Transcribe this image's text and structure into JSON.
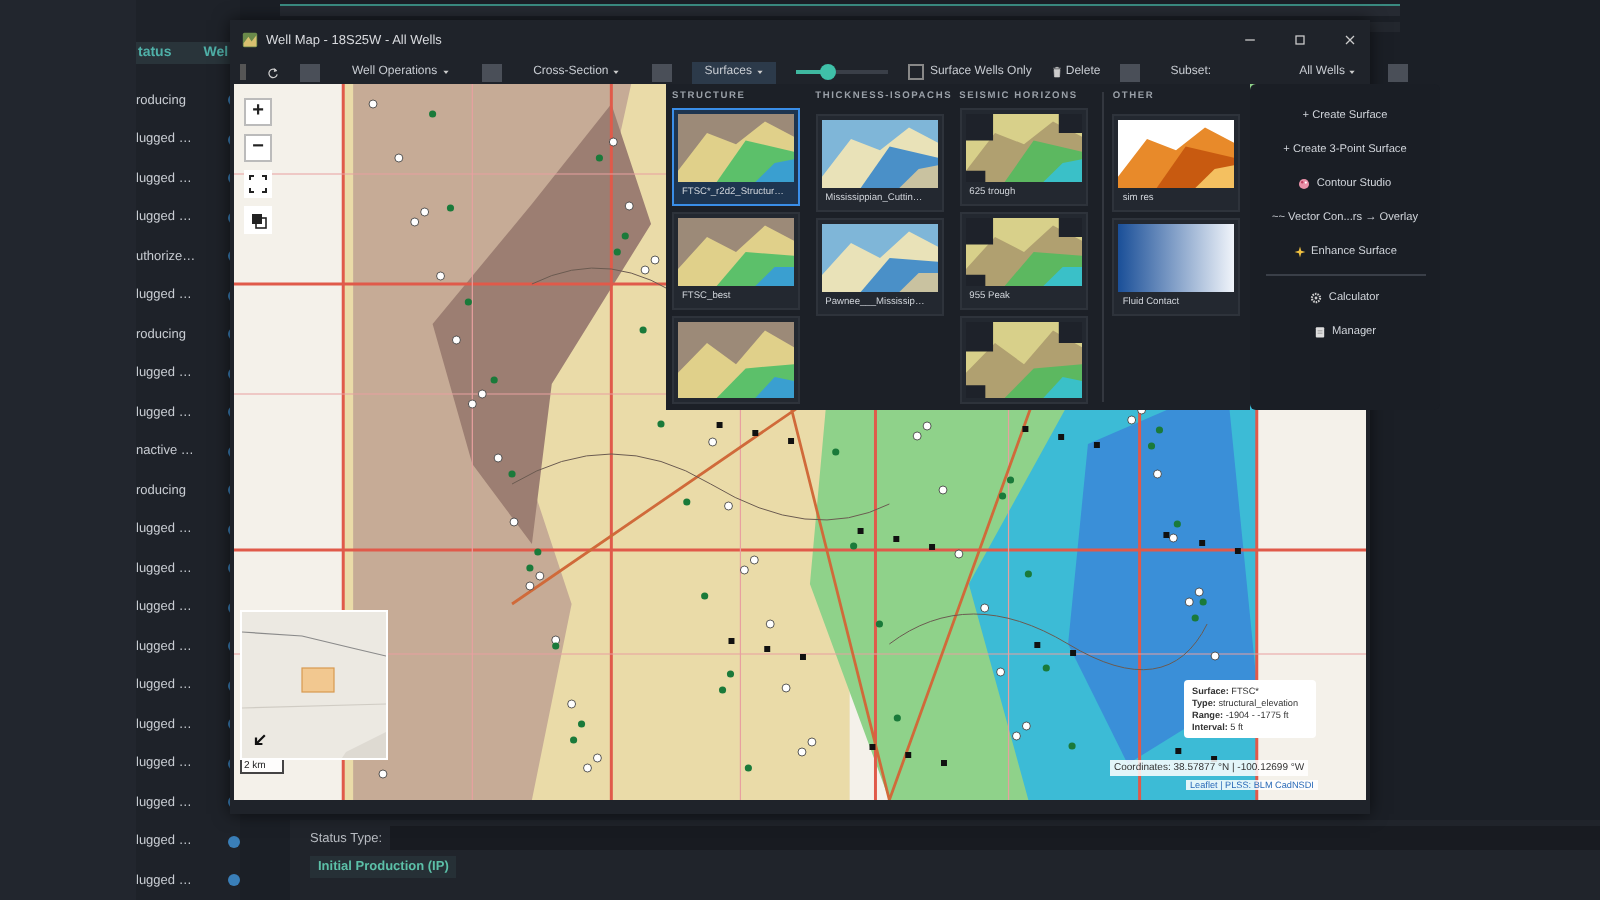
{
  "list": {
    "columns": [
      "tatus",
      "Wel"
    ],
    "rows": [
      {
        "status": "roducing"
      },
      {
        "status": "lugged …"
      },
      {
        "status": "lugged …"
      },
      {
        "status": "lugged …"
      },
      {
        "status": "uthorize…"
      },
      {
        "status": "lugged …"
      },
      {
        "status": "roducing"
      },
      {
        "status": "lugged …"
      },
      {
        "status": "lugged …"
      },
      {
        "status": "nactive …"
      },
      {
        "status": "roducing"
      },
      {
        "status": "lugged …"
      },
      {
        "status": "lugged …"
      },
      {
        "status": "lugged …"
      },
      {
        "status": "lugged …"
      },
      {
        "status": "lugged …"
      },
      {
        "status": "lugged …"
      },
      {
        "status": "lugged …"
      },
      {
        "status": "lugged …"
      },
      {
        "status": "lugged …"
      },
      {
        "status": "lugged …"
      }
    ]
  },
  "window": {
    "title": "Well Map - 18S25W - All Wells"
  },
  "toolbar": [
    {
      "kind": "handle"
    },
    {
      "kind": "refresh"
    },
    {
      "kind": "square"
    },
    {
      "kind": "menu",
      "label": "Well Operations",
      "selected": false
    },
    {
      "kind": "square"
    },
    {
      "kind": "menu",
      "label": "Cross-Section",
      "selected": false
    },
    {
      "kind": "square"
    },
    {
      "kind": "menu",
      "label": "Surfaces",
      "selected": true
    },
    {
      "kind": "slider",
      "level": 0.35
    },
    {
      "kind": "checkbox",
      "label": "Surface Wells Only",
      "checked": false
    },
    {
      "kind": "delete",
      "label": "Delete"
    },
    {
      "kind": "square"
    },
    {
      "kind": "label",
      "label": "Subset:"
    },
    {
      "kind": "menu",
      "label": "All Wells",
      "selected": false
    },
    {
      "kind": "square"
    }
  ],
  "surfaces_panel": {
    "categories": [
      {
        "title": "STRUCTURE",
        "surfaces": [
          {
            "name": "FTSC*_r2d2_Structur…",
            "selected": true
          },
          {
            "name": "FTSC_best",
            "selected": false
          },
          {
            "selected": false
          }
        ]
      },
      {
        "title": "THICKNESS-ISOPACHS",
        "surfaces": [
          {
            "name": "Mississippian_Cuttin…",
            "selected": false
          },
          {
            "name": "Pawnee___Mississip…",
            "selected": false
          }
        ]
      },
      {
        "title": "SEISMIC HORIZONS",
        "surfaces": [
          {
            "name": "625 trough",
            "selected": false
          },
          {
            "name": "955 Peak",
            "selected": false
          },
          {
            "selected": false
          }
        ]
      },
      {
        "title": "OTHER",
        "surfaces": [
          {
            "name": "sim res",
            "selected": false
          },
          {
            "name": "Fluid Contact",
            "selected": false
          }
        ]
      }
    ]
  },
  "surfaces_menu": [
    {
      "kind": "text",
      "label": "+ Create Surface"
    },
    {
      "kind": "text",
      "label": "+ Create 3-Point Surface"
    },
    {
      "kind": "palette",
      "label": "Contour Studio"
    },
    {
      "kind": "text",
      "label": "~~ Vector Con...rs → Overlay"
    },
    {
      "kind": "sparkle",
      "label": "Enhance Surface"
    },
    {
      "kind": "divider"
    },
    {
      "kind": "gear",
      "label": "Calculator"
    },
    {
      "kind": "clipboard",
      "label": "Manager"
    }
  ],
  "map": {
    "zoom_in": "+",
    "zoom_out": "−",
    "scale": "2 km",
    "tooltip": [
      "**Surface:** FTSC*",
      "**Type:** structural_elevation",
      "**Range:** -1904 - -1775 ft",
      "**Interval:** 5 ft"
    ],
    "coordinates": "Coordinates: 38.57877 °N | -100.12699 °W",
    "attribution": "Leaflet | PLSS: BLM CadNSDI"
  },
  "details": {
    "status_type_label": "Status Type:",
    "section_tab": "Initial Production (IP)"
  }
}
